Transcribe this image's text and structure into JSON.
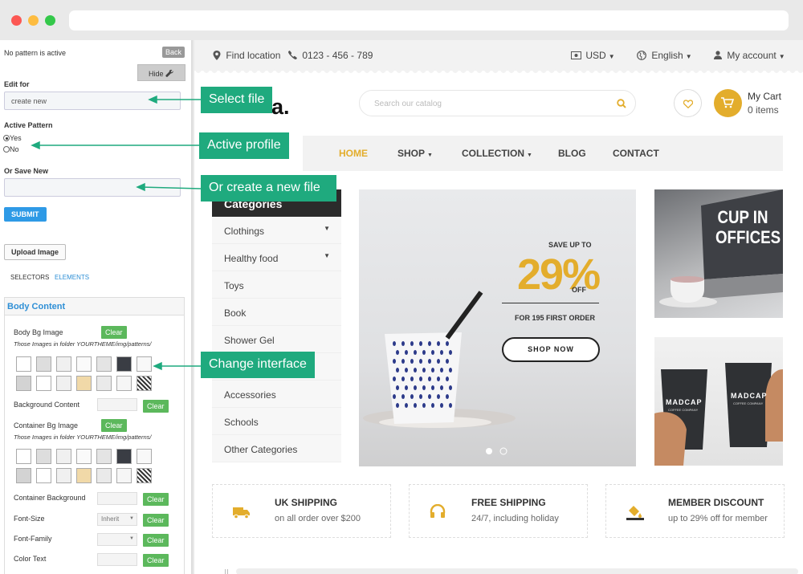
{
  "browser": {
    "dots": [
      "#fc5753",
      "#fdbc40",
      "#34c84a"
    ]
  },
  "panel": {
    "status": "No pattern is active",
    "back": "Back",
    "hide": "Hide",
    "edit_for_label": "Edit for",
    "edit_for_value": "create new",
    "active_pattern_label": "Active Pattern",
    "yes": "Yes",
    "no": "No",
    "or_save_new_label": "Or Save New",
    "submit": "SUBMIT",
    "upload": "Upload Image",
    "tab_selectors": "SELECTORS",
    "tab_elements": "ELEMENTS",
    "box_title": "Body Content",
    "body_bg_image": "Body Bg Image",
    "clear": "Clear",
    "folder_note": "Those Images in folder YOURTHEME/img/patterns/",
    "background_content": "Background Content",
    "container_bg_image": "Container Bg Image",
    "container_background": "Container Background",
    "font_size": "Font-Size",
    "font_size_value": "Inherit",
    "font_family": "Font-Family",
    "color_text": "Color Text"
  },
  "callouts": {
    "select_file": "Select file",
    "active_profile": "Active profile",
    "create_new": "Or create a new file",
    "change_interface": "Change interface"
  },
  "store": {
    "find_location": "Find location",
    "phone": "0123 - 456 - 789",
    "currency": "USD",
    "language": "English",
    "account": "My account",
    "logo": "a.",
    "search_placeholder": "Search our catalog",
    "cart_title": "My Cart",
    "cart_items": "0 items",
    "nav": [
      "HOME",
      "SHOP",
      "COLLECTION",
      "BLOG",
      "CONTACT"
    ],
    "categories_title": "Categories",
    "categories": [
      "Clothings",
      "Healthy food",
      "Toys",
      "Book",
      "Shower Gel",
      "",
      "Accessories",
      "Schools",
      "Other Categories"
    ],
    "hero": {
      "save_up": "SAVE UP TO",
      "percent": "29%",
      "off": "OFF",
      "first_order": "FOR 195 FIRST ORDER",
      "shop_now": "SHOP NOW"
    },
    "side1_text": "CUP IN OFFICES",
    "side2_brand": "MADCAP",
    "side2_sub": "COFFEE COMPANY",
    "features": [
      {
        "title": "UK SHIPPING",
        "sub": "on all order over $200"
      },
      {
        "title": "FREE SHIPPING",
        "sub": "24/7, including holiday"
      },
      {
        "title": "MEMBER DISCOUNT",
        "sub": "up to 29% off for member"
      }
    ]
  },
  "colors": {
    "accent": "#e3ad2c",
    "callout": "#1faa7e",
    "link": "#2e8fd6"
  }
}
